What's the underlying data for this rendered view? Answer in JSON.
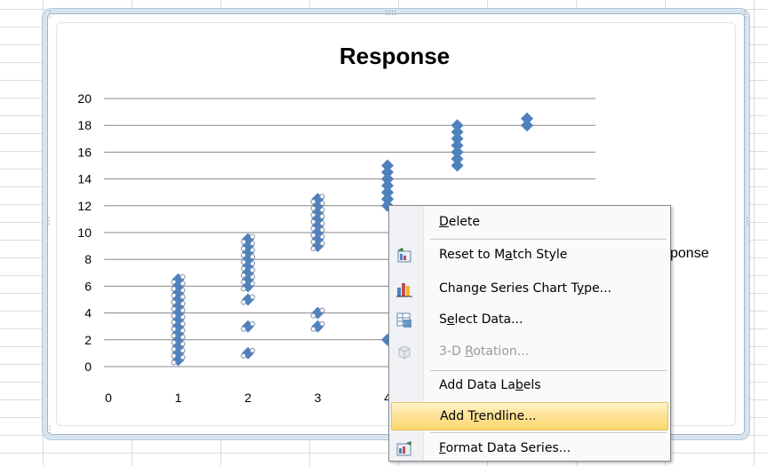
{
  "chart": {
    "title": "Response",
    "legend_text": "sponse",
    "chart_data": {
      "type": "scatter",
      "title": "Response",
      "xlim": [
        0,
        7
      ],
      "ylim": [
        0,
        20
      ],
      "x_ticks": [
        "0",
        "1",
        "2",
        "3",
        "4"
      ],
      "y_ticks": [
        "0",
        "2",
        "4",
        "6",
        "8",
        "10",
        "12",
        "14",
        "16",
        "18",
        "20"
      ],
      "grid": "horizontal",
      "series": [
        {
          "marker": "diamond",
          "color": "#4f81bd",
          "x": [
            1,
            1,
            1,
            1,
            1,
            1,
            1,
            1,
            1,
            1,
            1,
            1,
            1,
            1,
            1,
            1,
            1,
            1,
            2,
            2,
            2,
            2,
            2,
            2,
            2,
            2,
            2,
            2,
            2,
            2,
            2,
            3,
            3,
            3,
            3,
            3,
            3,
            3,
            3,
            3,
            3,
            3,
            3,
            4,
            4,
            4,
            4,
            4,
            4,
            4,
            4,
            4,
            4,
            4,
            5,
            5,
            5,
            5,
            5,
            5,
            5,
            6,
            6
          ],
          "y": [
            0.5,
            1,
            1.5,
            2,
            3,
            3.5,
            4,
            4.5,
            5,
            5.5,
            6,
            6.5,
            2.5,
            3,
            4,
            4.5,
            5,
            6,
            1,
            3,
            5,
            6,
            6.5,
            7,
            7.5,
            8,
            8.5,
            9,
            9.5,
            8,
            7,
            3,
            4,
            9,
            9.5,
            10,
            10.5,
            11,
            11.5,
            12,
            12.5,
            10,
            11,
            2,
            12,
            12.5,
            13,
            13.5,
            14,
            14.5,
            15,
            13,
            14,
            12.5,
            15,
            15.5,
            16,
            16.5,
            17,
            17.5,
            18,
            18,
            18.5
          ]
        }
      ]
    }
  },
  "context_menu": {
    "items": [
      {
        "label_pre": "",
        "label_ul": "D",
        "label_post": "elete",
        "icon": "none",
        "enabled": true
      },
      {
        "label_pre": "Reset to M",
        "label_ul": "a",
        "label_post": "tch Style",
        "icon": "reset-style-icon",
        "enabled": true
      },
      {
        "label_pre": "Change Series Chart T",
        "label_ul": "y",
        "label_post": "pe...",
        "icon": "chart-type-icon",
        "enabled": true
      },
      {
        "label_pre": "S",
        "label_ul": "e",
        "label_post": "lect Data...",
        "icon": "select-data-icon",
        "enabled": true
      },
      {
        "label_pre": "3-D ",
        "label_ul": "R",
        "label_post": "otation...",
        "icon": "3d-rotation-icon",
        "enabled": false
      },
      {
        "label_pre": "Add Data La",
        "label_ul": "b",
        "label_post": "els",
        "icon": "none",
        "enabled": true
      },
      {
        "label_pre": "Add T",
        "label_ul": "r",
        "label_post": "endline...",
        "icon": "none",
        "enabled": true,
        "highlighted": true
      },
      {
        "label_pre": "",
        "label_ul": "F",
        "label_post": "ormat Data Series...",
        "icon": "format-series-icon",
        "enabled": true
      }
    ]
  },
  "colors": {
    "marker": "#4f81bd",
    "gridline": "#878787",
    "menu_highlight": "#fbd76b"
  }
}
